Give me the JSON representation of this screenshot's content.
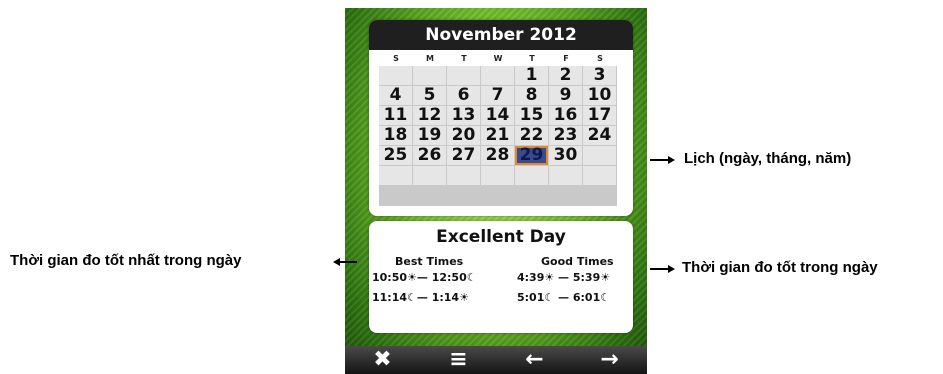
{
  "calendar": {
    "month_year": "November 2012",
    "weekdays": [
      "S",
      "M",
      "T",
      "W",
      "T",
      "F",
      "S"
    ],
    "weeks": [
      [
        "",
        "",
        "",
        "",
        "1",
        "2",
        "3"
      ],
      [
        "4",
        "5",
        "6",
        "7",
        "8",
        "9",
        "10"
      ],
      [
        "11",
        "12",
        "13",
        "14",
        "15",
        "16",
        "17"
      ],
      [
        "18",
        "19",
        "20",
        "21",
        "22",
        "23",
        "24"
      ],
      [
        "25",
        "26",
        "27",
        "28",
        "29",
        "30",
        ""
      ],
      [
        "",
        "",
        "",
        "",
        "",
        "",
        ""
      ]
    ],
    "selected_day": "29"
  },
  "times": {
    "title": "Excellent Day",
    "best_header": "Best Times",
    "good_header": "Good Times",
    "best": [
      "10:50☀— 12:50☾",
      "11:14☾— 1:14☀"
    ],
    "good": [
      "4:39☀ — 5:39☀",
      "5:01☾ — 6:01☾"
    ]
  },
  "toolbar": {
    "close": "✖",
    "menu": "≡",
    "prev": "←",
    "next": "→"
  },
  "annotations": {
    "calendar": "Lịch (ngày, tháng, năm)",
    "best": "Thời gian đo tốt nhất trong ngày",
    "good": "Thời gian đo tốt trong ngày"
  },
  "colors": {
    "accent_green": "#6fbe28",
    "header_dark": "#1f1f1f",
    "selected_border": "#e08a2a"
  }
}
